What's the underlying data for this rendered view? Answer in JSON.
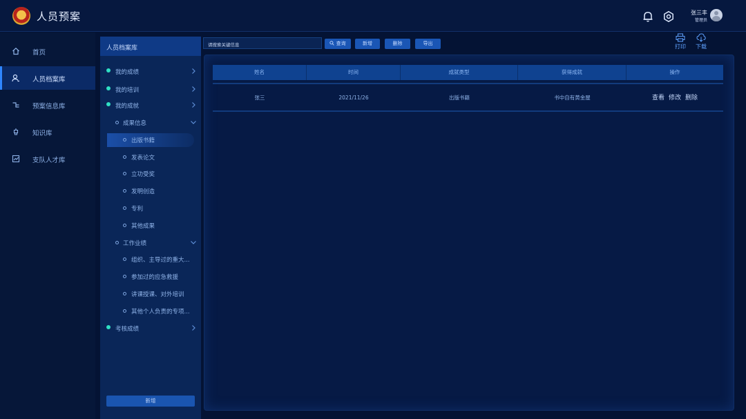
{
  "header": {
    "title": "人员预案",
    "user_name": "张三丰",
    "user_role": "管理员",
    "icons": [
      "bell-icon",
      "gear-icon",
      "avatar"
    ]
  },
  "nav": {
    "items": [
      {
        "label": "首页",
        "icon": "home-icon"
      },
      {
        "label": "人员档案库",
        "icon": "user-icon",
        "active": true
      },
      {
        "label": "预案信息库",
        "icon": "branch-icon"
      },
      {
        "label": "知识库",
        "icon": "lightbulb-icon"
      },
      {
        "label": "支队人才库",
        "icon": "chart-icon"
      }
    ]
  },
  "tree": {
    "header": "人员档案库",
    "items": [
      {
        "label": "我的成绩",
        "level": 1
      },
      {
        "label": "我的培训",
        "level": 1
      },
      {
        "label": "我的成就",
        "level": 1
      },
      {
        "label": "成果信息",
        "level": 2
      },
      {
        "label": "出版书籍",
        "level": 3,
        "selected": true
      },
      {
        "label": "发表论文",
        "level": 3
      },
      {
        "label": "立功受奖",
        "level": 3
      },
      {
        "label": "发明创造",
        "level": 3
      },
      {
        "label": "专利",
        "level": 3
      },
      {
        "label": "其他成果",
        "level": 3
      },
      {
        "label": "工作业绩",
        "level": 2
      },
      {
        "label": "组织、主导过的重大...",
        "level": 3
      },
      {
        "label": "参加过的应急救援",
        "level": 3
      },
      {
        "label": "讲课授课、对外培训",
        "level": 3
      },
      {
        "label": "其他个人负责的专项...",
        "level": 3
      },
      {
        "label": "考核成绩",
        "level": 1
      }
    ],
    "add_label": "新增"
  },
  "toolbar": {
    "search_placeholder": "请搜索关键信息",
    "query_label": "查询",
    "add_label": "新增",
    "delete_label": "删除",
    "export_label": "导出",
    "print_label": "打印",
    "download_label": "下载"
  },
  "table": {
    "columns": [
      "姓名",
      "时间",
      "成就类型",
      "获得成就",
      "操作"
    ],
    "rows": [
      {
        "name": "张三",
        "time": "2021/11/26",
        "type": "出版书籍",
        "achievement": "书中自有黄金屋",
        "actions": [
          "查看",
          "修改",
          "删除"
        ]
      }
    ]
  },
  "colors": {
    "background": "#041334",
    "accent": "#2f86ff",
    "active_dot": "#2fe0c4",
    "table_header": "#0f4290"
  }
}
